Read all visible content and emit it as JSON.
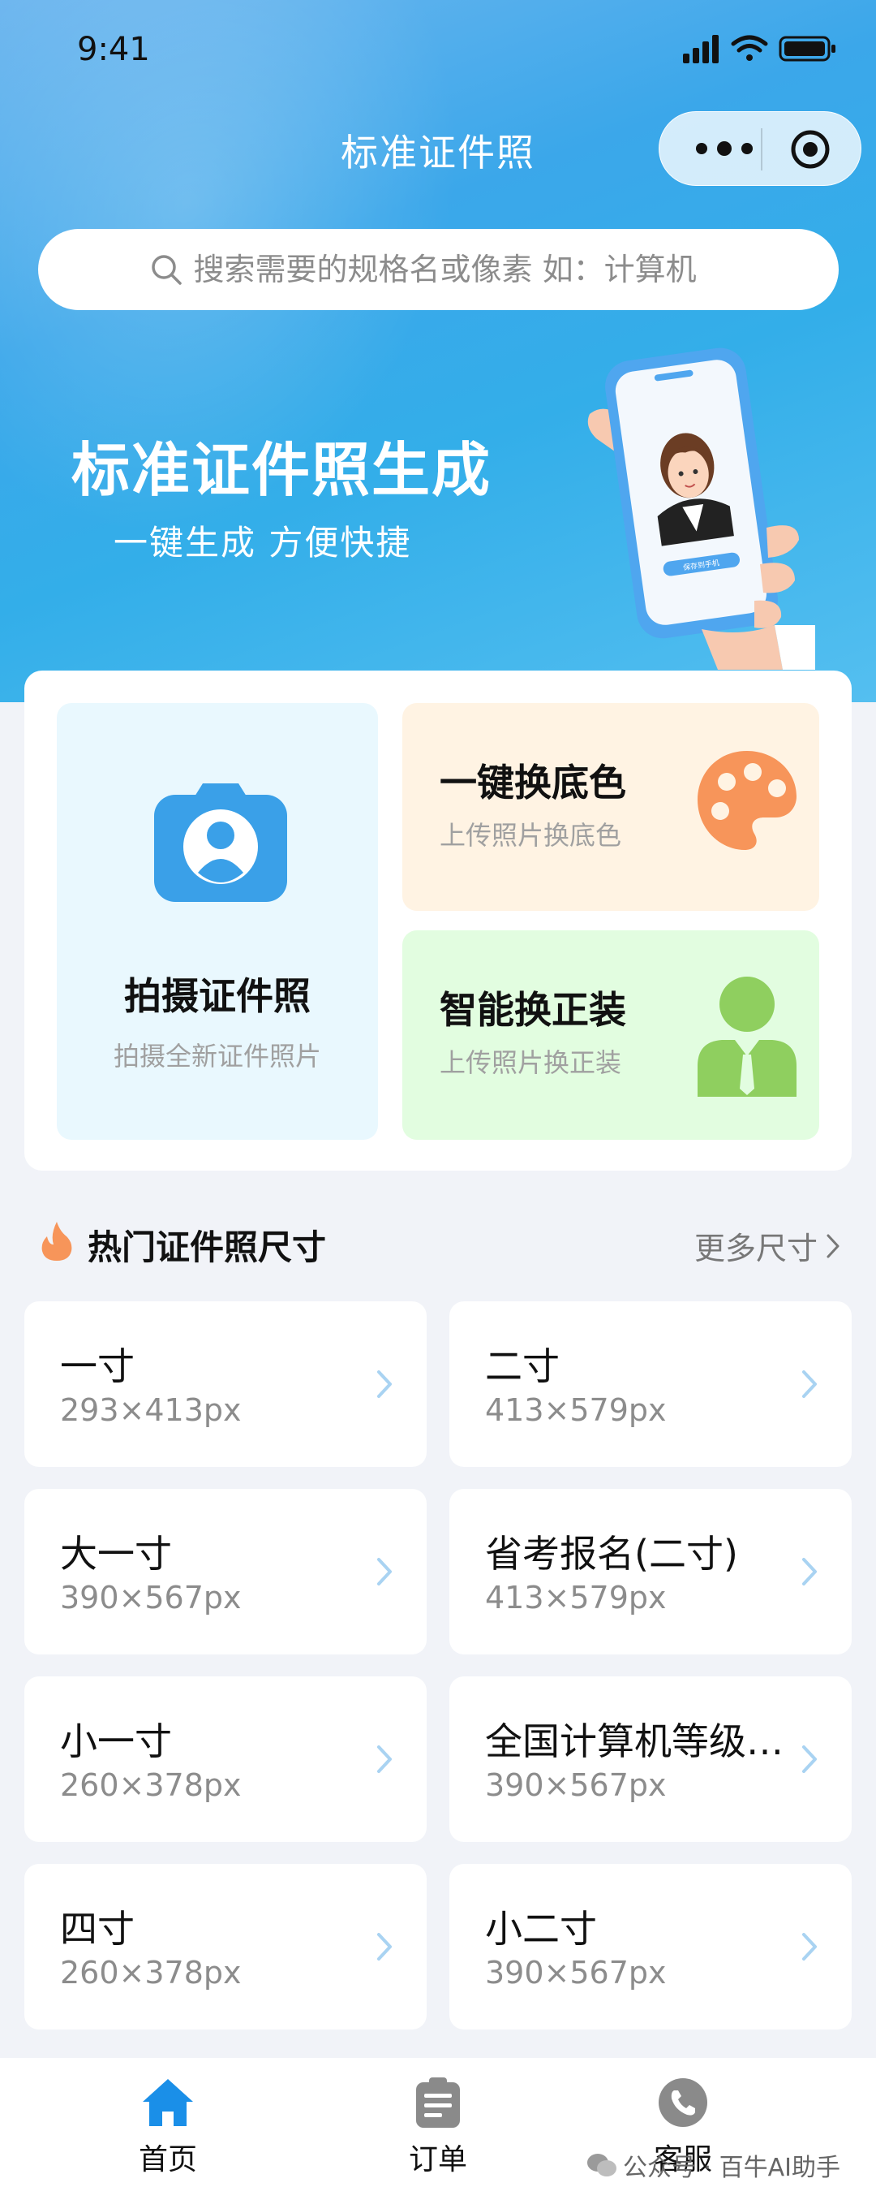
{
  "status_bar": {
    "time": "9:41"
  },
  "nav": {
    "title": "标准证件照"
  },
  "search": {
    "placeholder": "搜索需要的规格名或像素 如：计算机"
  },
  "hero": {
    "title": "标准证件照生成",
    "subtitle": "一键生成 方便快捷",
    "phone_button_label": "保存到手机"
  },
  "features": {
    "shoot": {
      "title": "拍摄证件照",
      "subtitle": "拍摄全新证件照片"
    },
    "background": {
      "title": "一键换底色",
      "subtitle": "上传照片换底色"
    },
    "suit": {
      "title": "智能换正装",
      "subtitle": "上传照片换正装"
    }
  },
  "hot_sizes": {
    "title": "热门证件照尺寸",
    "more_label": "更多尺寸",
    "items": [
      {
        "name": "一寸",
        "pixels": "293×413px"
      },
      {
        "name": "二寸",
        "pixels": "413×579px"
      },
      {
        "name": "大一寸",
        "pixels": "390×567px"
      },
      {
        "name": "省考报名(二寸)",
        "pixels": "413×579px"
      },
      {
        "name": "小一寸",
        "pixels": "260×378px"
      },
      {
        "name": "全国计算机等级…",
        "pixels": "390×567px"
      },
      {
        "name": "四寸",
        "pixels": "260×378px"
      },
      {
        "name": "小二寸",
        "pixels": "390×567px"
      }
    ]
  },
  "tabbar": {
    "items": [
      {
        "label": "首页",
        "icon": "home-icon",
        "active": true
      },
      {
        "label": "订单",
        "icon": "clipboard-icon",
        "active": false
      },
      {
        "label": "客服",
        "icon": "phone-icon",
        "active": false
      }
    ]
  },
  "watermark": {
    "text": "公众号 · 百牛AI助手"
  },
  "colors": {
    "hero_blue": "#3ba7ea",
    "primary_blue": "#3aa0e8",
    "orange": "#f7955a",
    "green": "#8fcf5f"
  }
}
